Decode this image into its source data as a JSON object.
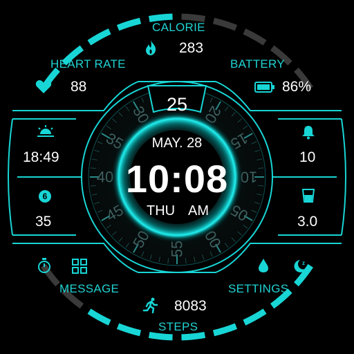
{
  "colors": {
    "accent": "#19d6d6",
    "dim": "#3a3a3a",
    "background": "#000000",
    "text": "#ffffff"
  },
  "calorie": {
    "label": "CALORIE",
    "value": "283",
    "icon": "flame-icon"
  },
  "heart_rate": {
    "label": "HEART RATE",
    "value": "88",
    "icon": "heart-icon"
  },
  "battery": {
    "label": "BATTERY",
    "value": "86%",
    "icon": "battery-icon"
  },
  "sunrise": {
    "value": "18:49",
    "icon": "sunrise-icon"
  },
  "notifications": {
    "value": "10",
    "icon": "bell-icon"
  },
  "complication_left": {
    "badge": "6",
    "value": "35",
    "icon": "coin-icon"
  },
  "water": {
    "value": "3.0",
    "icon": "glass-icon"
  },
  "center": {
    "date": "MAY. 28",
    "time": "10:08",
    "day": "THU",
    "ampm": "AM",
    "seconds_top": "25"
  },
  "dial_numbers": [
    "30",
    "35",
    "40",
    "45",
    "50",
    "55",
    "00",
    "05",
    "10",
    "15",
    "20"
  ],
  "shortcuts": {
    "message": "MESSAGE",
    "settings": "SETTINGS",
    "icons": [
      "stopwatch-icon",
      "apps-grid-icon",
      "drop-icon",
      "sleep-icon"
    ]
  },
  "steps": {
    "label": "STEPS",
    "value": "8083",
    "icon": "running-icon"
  },
  "calorie_progress": 0.5,
  "steps_progress": 0.82
}
